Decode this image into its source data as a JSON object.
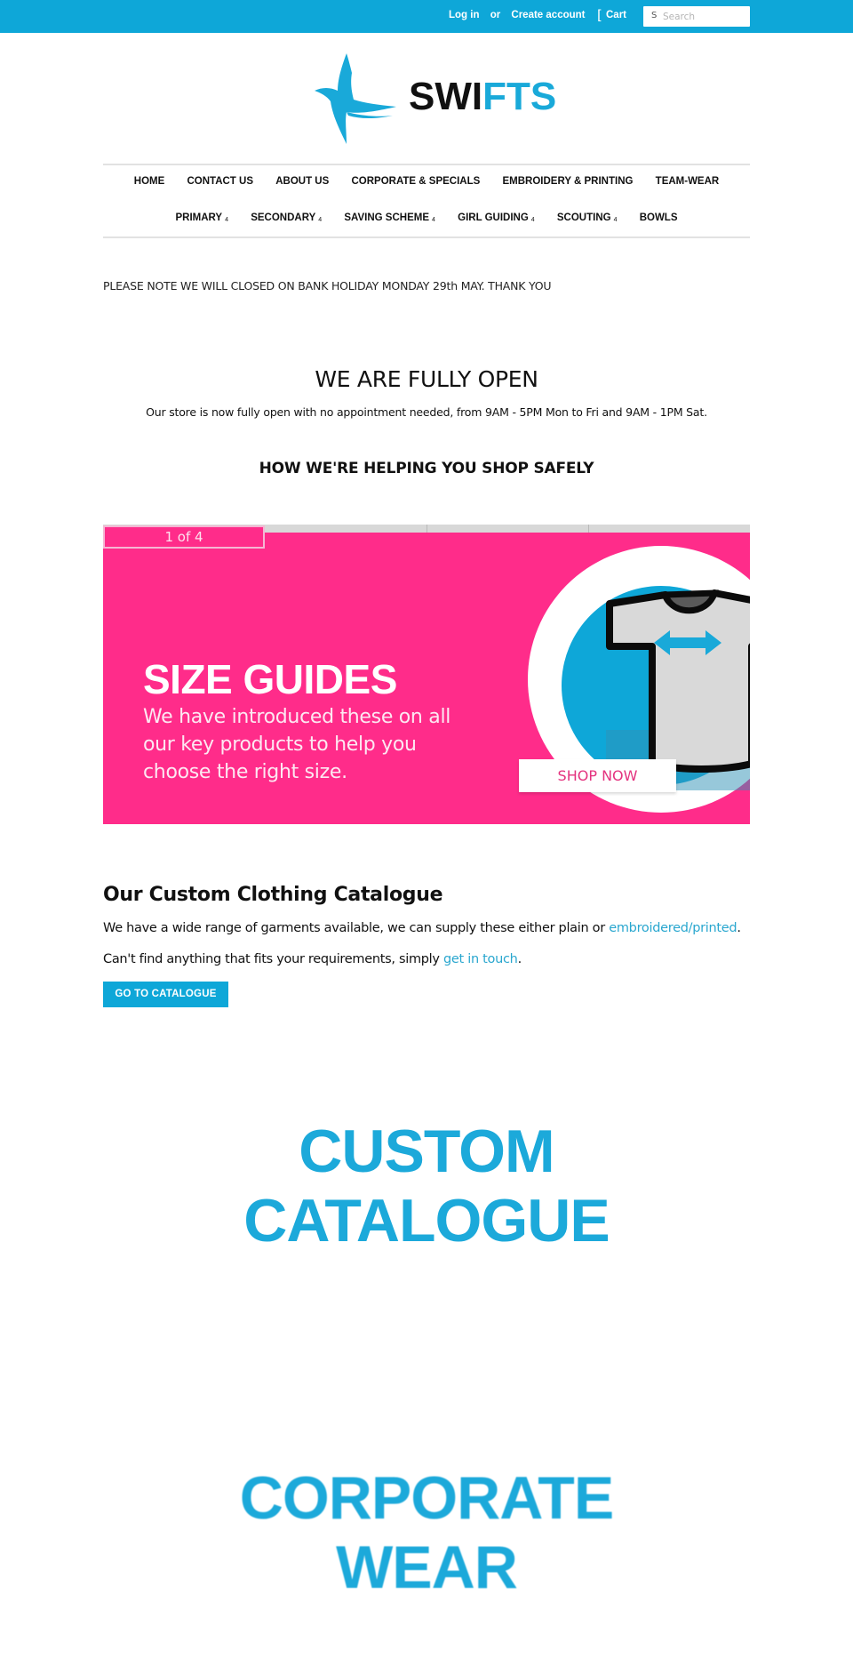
{
  "topbar": {
    "login_label": "Log in",
    "or_label": "or",
    "create_account_label": "Create account",
    "cart_icon": "[",
    "cart_label": "Cart",
    "search_icon": "S",
    "search_placeholder": "Search",
    "search_value": ""
  },
  "logo": {
    "word_dark": "SWI",
    "word_blue": "FTS",
    "alt": "Swifts"
  },
  "nav": {
    "row1": [
      {
        "label": "HOME"
      },
      {
        "label": "CONTACT US"
      },
      {
        "label": "ABOUT US"
      },
      {
        "label": "CORPORATE & SPECIALS"
      },
      {
        "label": "EMBROIDERY & PRINTING"
      },
      {
        "label": "TEAM-WEAR"
      }
    ],
    "row2": [
      {
        "label": "PRIMARY",
        "arrow": "4"
      },
      {
        "label": "SECONDARY",
        "arrow": "4"
      },
      {
        "label": "SAVING SCHEME",
        "arrow": "4"
      },
      {
        "label": "GIRL GUIDING",
        "arrow": "4"
      },
      {
        "label": "SCOUTING",
        "arrow": "4"
      },
      {
        "label": "BOWLS"
      }
    ]
  },
  "notice": "PLEASE NOTE WE WILL CLOSED ON BANK HOLIDAY MONDAY 29th MAY. THANK YOU",
  "open_section": {
    "heading": "WE ARE FULLY OPEN",
    "text": "Our store is now fully open with no appointment needed, from 9AM - 5PM Mon to Fri and 9AM - 1PM Sat.",
    "safety_heading": "HOW WE'RE HELPING YOU SHOP SAFELY"
  },
  "slider": {
    "counter": "1 of 4",
    "current": 1,
    "total": 4,
    "slide": {
      "title": "SIZE GUIDES",
      "description": "We have introduced these on all our key products to help you choose the right size.",
      "cta": "SHOP NOW",
      "colors": {
        "background": "#ff2c8a",
        "circle": "#0ea7d8",
        "shirt": "#d9d9d9"
      }
    }
  },
  "catalogue": {
    "heading": "Our Custom Clothing Catalogue",
    "p1_before": "We have a wide range of garments available, we can supply these either plain or ",
    "p1_link": "embroidered/printed",
    "p1_after": ".",
    "p2_before": "Can't find anything that fits your requirements, simply ",
    "p2_link": "get in touch",
    "p2_after": ".",
    "button": "GO TO CATALOGUE"
  },
  "promos": [
    {
      "lines": [
        "CUSTOM",
        "CATALOGUE"
      ]
    },
    {
      "lines": [
        "CORPORATE",
        "WEAR"
      ]
    }
  ],
  "colors": {
    "brand_blue": "#0ea7d8",
    "link": "#2aa7cf",
    "pink": "#ff2c8a"
  }
}
